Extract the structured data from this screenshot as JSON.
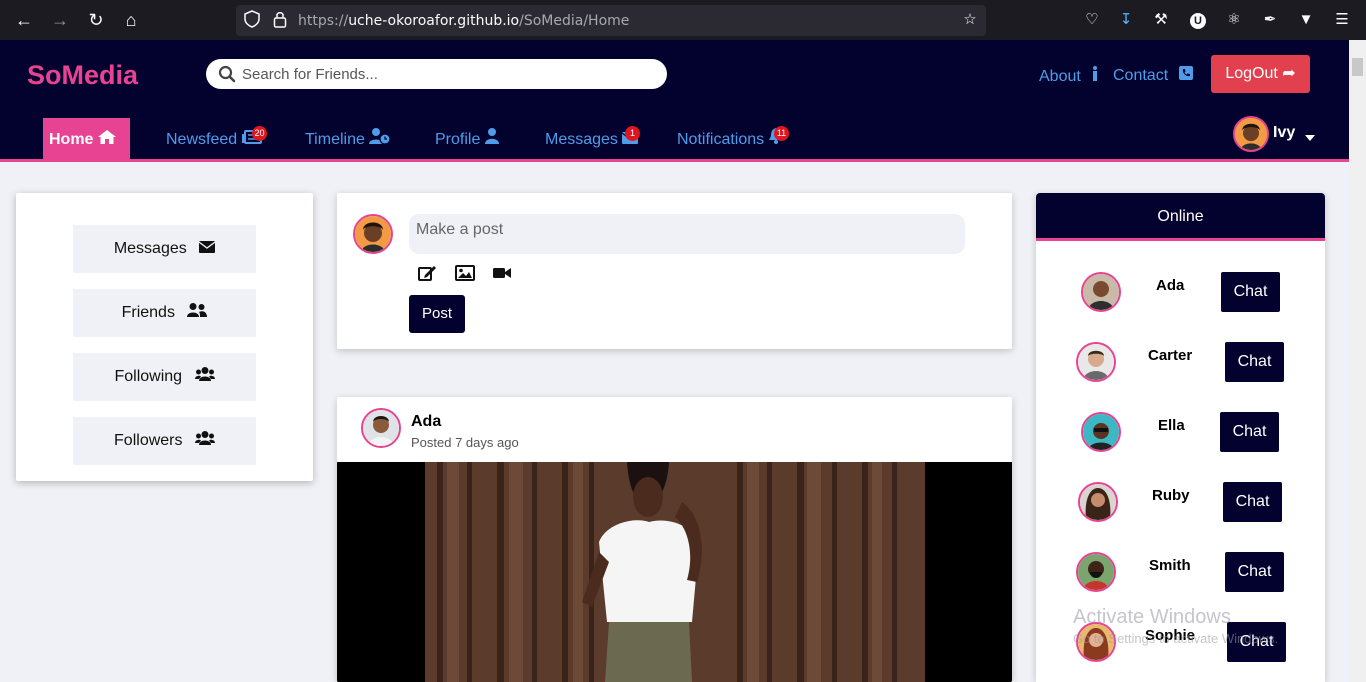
{
  "browser": {
    "url_prefix": "https://",
    "url_host": "uche-okoroafor.github.io",
    "url_path": "/SoMedia/Home"
  },
  "header": {
    "logo": "SoMedia",
    "search_placeholder": "Search for Friends...",
    "about": "About",
    "contact": "Contact",
    "logout": "LogOut",
    "user_name": "Ivy"
  },
  "nav": {
    "home": "Home",
    "newsfeed": "Newsfeed",
    "newsfeed_badge": "20",
    "timeline": "Timeline",
    "profile": "Profile",
    "messages": "Messages",
    "messages_badge": "1",
    "notifications": "Notifications",
    "notifications_badge": "11"
  },
  "sidebar": {
    "items": [
      {
        "label": "Messages"
      },
      {
        "label": "Friends"
      },
      {
        "label": "Following"
      },
      {
        "label": "Followers"
      }
    ]
  },
  "composer": {
    "placeholder": "Make a post",
    "post_button": "Post"
  },
  "post": {
    "author": "Ada",
    "time": "Posted 7 days ago"
  },
  "online": {
    "title": "Online",
    "chat_label": "Chat",
    "users": [
      {
        "name": "Ada"
      },
      {
        "name": "Carter"
      },
      {
        "name": "Ella"
      },
      {
        "name": "Ruby"
      },
      {
        "name": "Smith"
      },
      {
        "name": "Sophie"
      }
    ]
  },
  "watermark": {
    "title": "Activate Windows",
    "subtitle": "Go to Settings to activate Windows."
  },
  "colors": {
    "navy": "#03022f",
    "pink": "#e84393",
    "link_blue": "#4f9de8",
    "logout_red": "#e23f4f"
  }
}
